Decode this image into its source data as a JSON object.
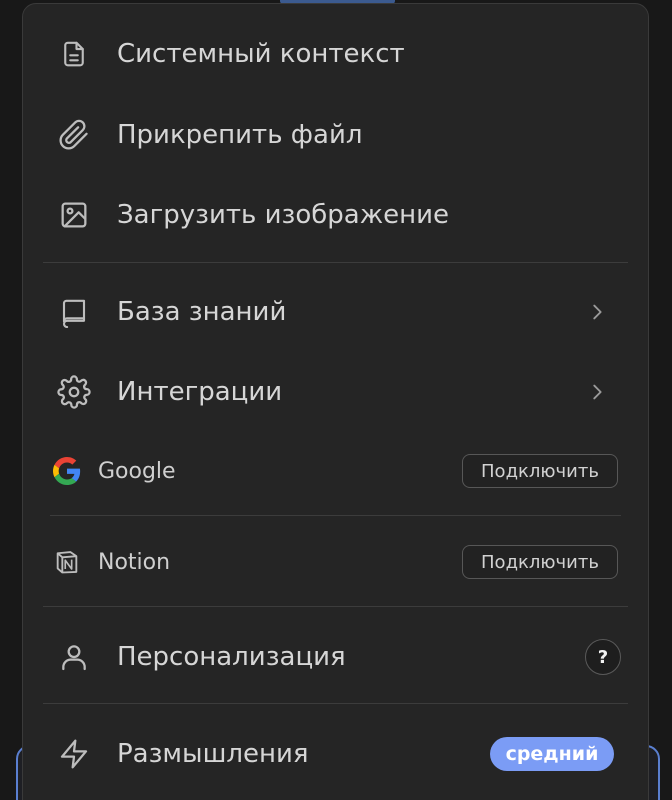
{
  "menu": {
    "items": [
      {
        "label": "Системный контекст",
        "icon": "document-icon"
      },
      {
        "label": "Прикрепить файл",
        "icon": "paperclip-icon"
      },
      {
        "label": "Загрузить изображение",
        "icon": "image-icon"
      },
      {
        "label": "База знаний",
        "icon": "book-icon"
      },
      {
        "label": "Интеграции",
        "icon": "gear-icon"
      }
    ],
    "integrations": [
      {
        "name": "Google",
        "icon": "google-logo-icon",
        "action": "Подключить"
      },
      {
        "name": "Notion",
        "icon": "notion-logo-icon",
        "action": "Подключить"
      }
    ],
    "personalization": {
      "label": "Персонализация",
      "icon": "user-icon",
      "help": "?"
    },
    "reasoning": {
      "label": "Размышления",
      "icon": "lightning-icon",
      "level": "средний"
    }
  },
  "colors": {
    "menu_bg": "#252525",
    "text": "#d6d6d6",
    "badge_bg": "#7b9cf5",
    "divider": "#3c3c3c"
  }
}
